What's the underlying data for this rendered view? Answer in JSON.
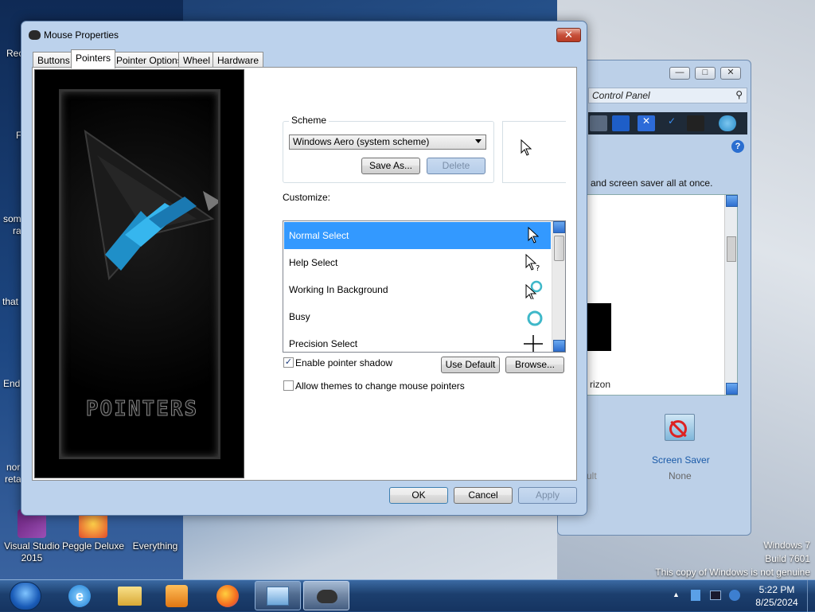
{
  "desktop": {
    "icons": [
      {
        "label": "Visual Studio 2015"
      },
      {
        "label": "Peggle Deluxe"
      },
      {
        "label": "Everything"
      }
    ],
    "partial_labels": [
      "Rec",
      "F",
      "som",
      "ra",
      "that",
      "End",
      "nor",
      "reta"
    ],
    "watermark": [
      "Windows 7",
      "Build 7601",
      "This copy of Windows is not genuine"
    ]
  },
  "control_panel": {
    "address": "Control Panel",
    "description": "and screen saver all at once.",
    "horizon_text": "rizon",
    "ult_text": "ult",
    "screen_saver_label": "Screen Saver",
    "screen_saver_value": "None"
  },
  "dialog": {
    "title": "Mouse Properties",
    "tabs": [
      {
        "label": "Buttons",
        "active": false
      },
      {
        "label": "Pointers",
        "active": true
      },
      {
        "label": "Pointer Options",
        "active": false
      },
      {
        "label": "Wheel",
        "active": false
      },
      {
        "label": "Hardware",
        "active": false
      }
    ],
    "art_caption": "POINTERS",
    "scheme": {
      "legend": "Scheme",
      "selected": "Windows Aero (system scheme)",
      "save_as_label": "Save As...",
      "delete_label": "Delete"
    },
    "customize_label": "Customize:",
    "cursor_list": [
      {
        "label": "Normal Select",
        "selected": true,
        "icon": "arrow-cursor-icon"
      },
      {
        "label": "Help Select",
        "selected": false,
        "icon": "help-cursor-icon"
      },
      {
        "label": "Working In Background",
        "selected": false,
        "icon": "working-cursor-icon"
      },
      {
        "label": "Busy",
        "selected": false,
        "icon": "busy-cursor-icon"
      },
      {
        "label": "Precision Select",
        "selected": false,
        "icon": "crosshair-cursor-icon"
      }
    ],
    "enable_shadow_label": "Enable pointer shadow",
    "enable_shadow_checked": true,
    "allow_themes_label": "Allow themes to change mouse pointers",
    "allow_themes_checked": false,
    "use_default_label": "Use Default",
    "browse_label": "Browse...",
    "ok_label": "OK",
    "cancel_label": "Cancel",
    "apply_label": "Apply"
  },
  "taskbar": {
    "time": "5:22 PM",
    "date": "8/25/2024"
  },
  "colors": {
    "selection": "#3399ff",
    "dialog_frame": "#bcd2ec",
    "taskbar": "#1c3f6e"
  }
}
